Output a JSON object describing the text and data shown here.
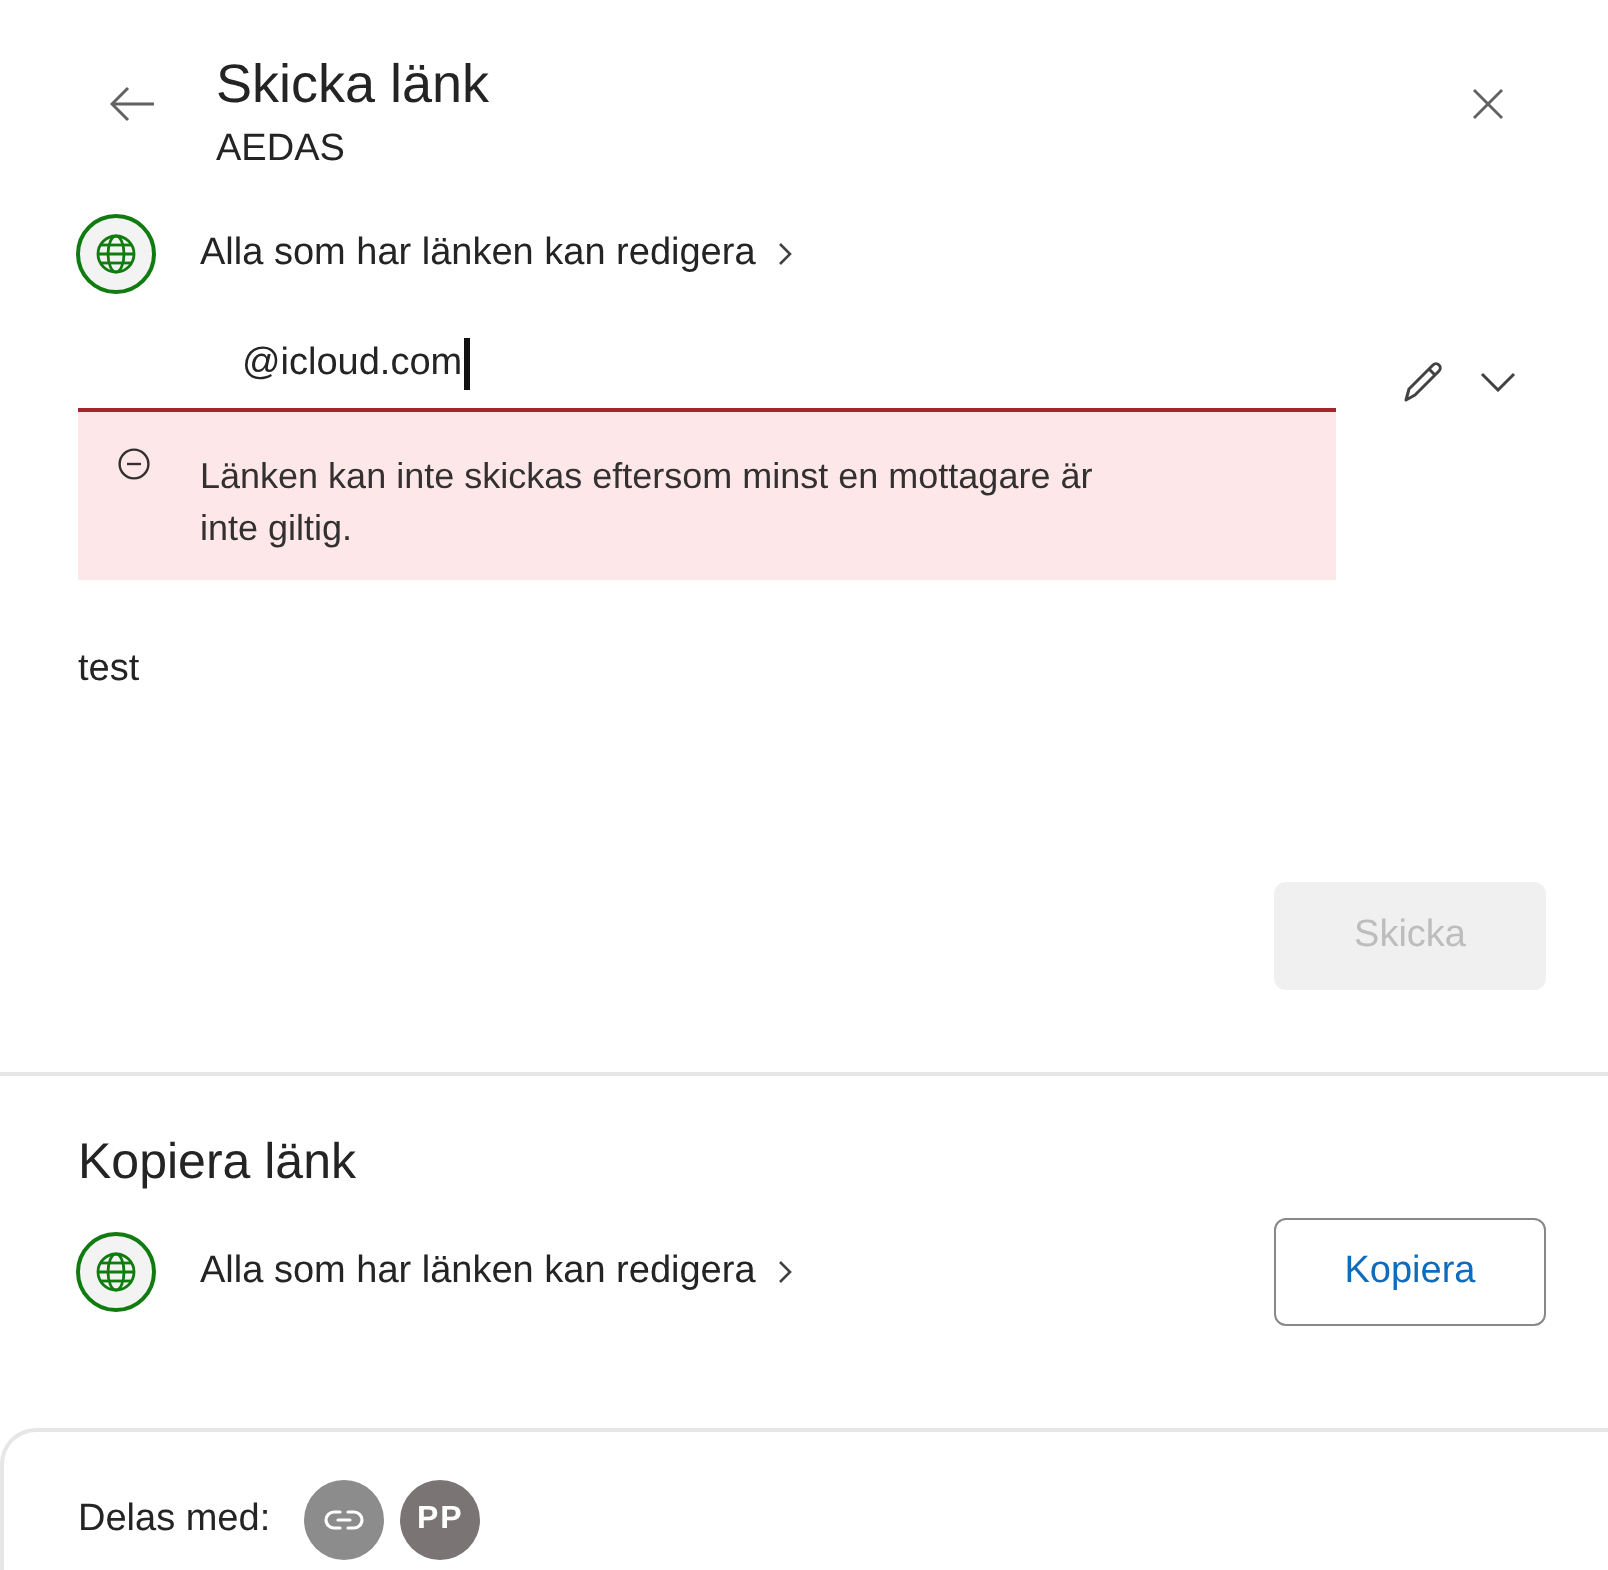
{
  "header": {
    "title": "Skicka länk",
    "subtitle": "AEDAS"
  },
  "send_link": {
    "permission": "Alla som har länken kan redigera",
    "recipient": {
      "value": "@icloud.com",
      "invalid": true
    },
    "error": "Länken kan inte skickas eftersom minst en mottagare är inte giltig.",
    "message": "test",
    "send_button": {
      "label": "Skicka",
      "disabled": true
    }
  },
  "copy_link": {
    "title": "Kopiera länk",
    "permission": "Alla som har länken kan redigera",
    "copy_button": {
      "label": "Kopiera"
    }
  },
  "shared_with": {
    "label": "Delas med:",
    "people": [
      {
        "kind": "link"
      },
      {
        "kind": "person",
        "initials": "PP"
      }
    ]
  }
}
